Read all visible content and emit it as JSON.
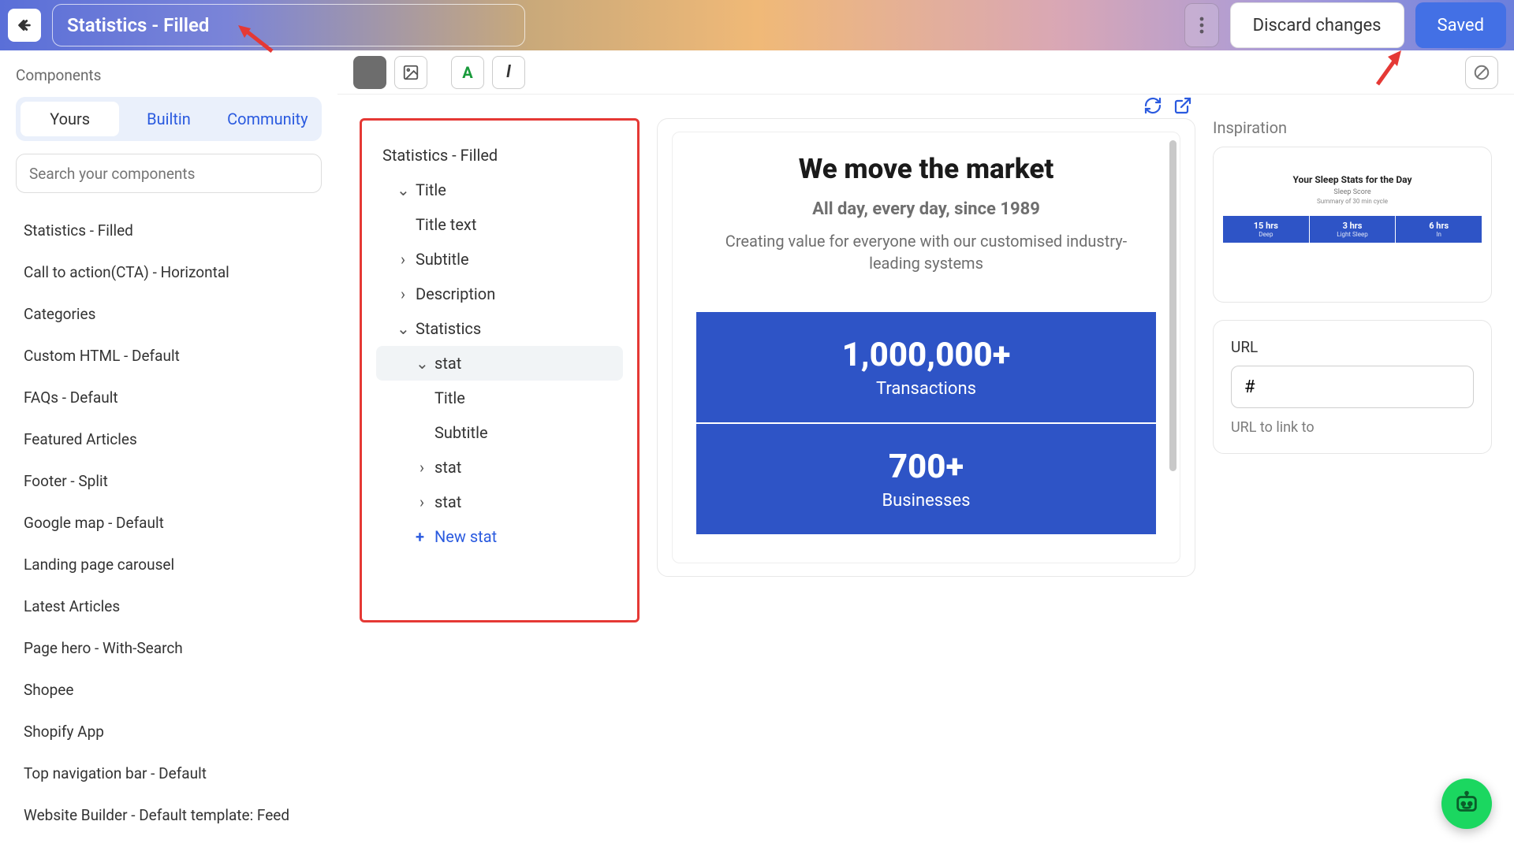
{
  "topbar": {
    "title_value": "Statistics - Filled",
    "discard_label": "Discard changes",
    "saved_label": "Saved"
  },
  "sidebar": {
    "heading": "Components",
    "tabs": {
      "yours": "Yours",
      "builtin": "Builtin",
      "community": "Community"
    },
    "search_placeholder": "Search your components",
    "items": [
      "Statistics - Filled",
      "Call to action(CTA) - Horizontal",
      "Categories",
      "Custom HTML - Default",
      "FAQs - Default",
      "Featured Articles",
      "Footer - Split",
      "Google map - Default",
      "Landing page carousel",
      "Latest Articles",
      "Page hero - With-Search",
      "Shopee",
      "Shopify App",
      "Top navigation bar - Default",
      "Website Builder - Default template: Feed"
    ]
  },
  "tree": {
    "root": "Statistics - Filled",
    "title": "Title",
    "title_text": "Title text",
    "subtitle": "Subtitle",
    "description": "Description",
    "statistics": "Statistics",
    "stat": "stat",
    "stat_title": "Title",
    "stat_subtitle": "Subtitle",
    "new_stat": "New stat"
  },
  "preview": {
    "title": "We move the market",
    "subtitle": "All day, every day, since 1989",
    "description": "Creating value for everyone with our customised industry-leading systems",
    "stats": [
      {
        "value": "1,000,000+",
        "label": "Transactions"
      },
      {
        "value": "700+",
        "label": "Businesses"
      }
    ]
  },
  "right": {
    "inspiration_label": "Inspiration",
    "insp_title": "Your Sleep Stats for the Day",
    "insp_sub": "Sleep Score",
    "insp_sub2": "Summary of 30 min cycle",
    "insp_cells": [
      {
        "n": "15 hrs",
        "l": "Deep"
      },
      {
        "n": "3 hrs",
        "l": "Light Sleep"
      },
      {
        "n": "6 hrs",
        "l": "In"
      }
    ],
    "url_label": "URL",
    "url_value": "#",
    "url_help": "URL to link to"
  }
}
